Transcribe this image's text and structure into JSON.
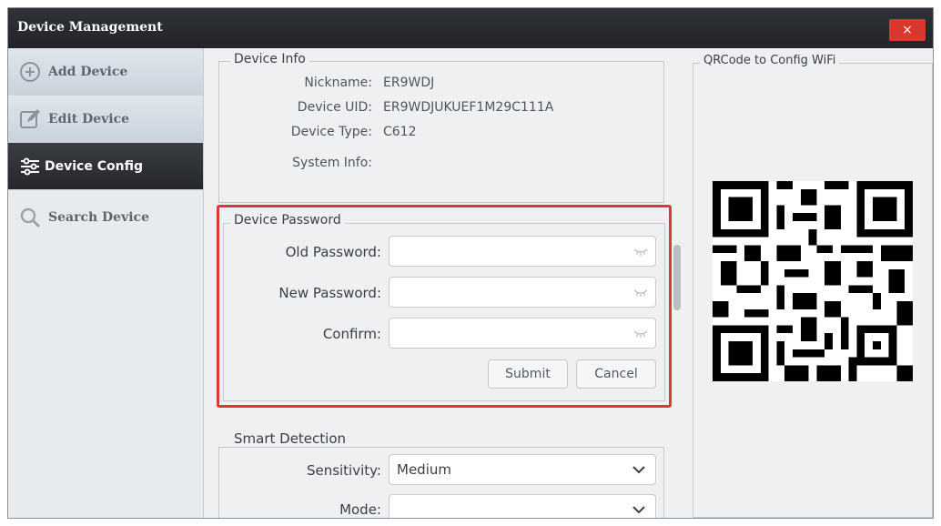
{
  "window": {
    "title": "Device Management",
    "close_label": "×"
  },
  "sidebar": {
    "items": [
      {
        "label": "Add Device",
        "icon": "plus-circle-icon"
      },
      {
        "label": "Edit Device",
        "icon": "edit-icon"
      },
      {
        "label": "Device Config",
        "icon": "sliders-icon",
        "active": true
      },
      {
        "label": "Search Device",
        "icon": "search-icon"
      }
    ]
  },
  "device_info": {
    "title": "Device Info",
    "rows": [
      {
        "label": "Nickname:",
        "value": "ER9WDJ"
      },
      {
        "label": "Device UID:",
        "value": "ER9WDJUKUEF1M29C111A"
      },
      {
        "label": "Device Type:",
        "value": "C612"
      },
      {
        "label": "System Info:",
        "value": ""
      }
    ]
  },
  "device_password": {
    "title": "Device Password",
    "old_label": "Old Password:",
    "new_label": "New Password:",
    "confirm_label": "Confirm:",
    "old_value": "",
    "new_value": "",
    "confirm_value": "",
    "submit_label": "Submit",
    "cancel_label": "Cancel"
  },
  "smart_detection": {
    "title": "Smart Detection",
    "sensitivity_label": "Sensitivity:",
    "sensitivity_value": "Medium",
    "mode_label": "Mode:",
    "mode_value": ""
  },
  "qr": {
    "title": "QRCode to Config WiFi"
  },
  "colors": {
    "highlight": "#d63a30",
    "close": "#d9392d",
    "active_nav": "#25272b"
  }
}
